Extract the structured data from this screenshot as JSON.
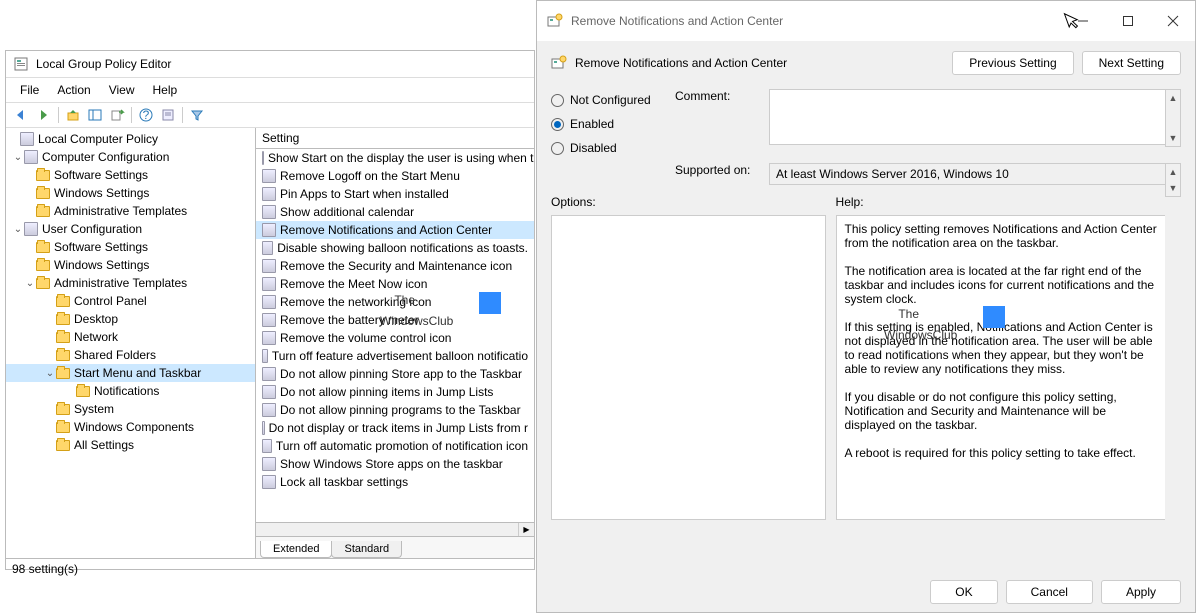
{
  "gpedit": {
    "title": "Local Group Policy Editor",
    "menus": [
      "File",
      "Action",
      "View",
      "Help"
    ],
    "tree": {
      "root": "Local Computer Policy",
      "cc": "Computer Configuration",
      "cc_children": [
        "Software Settings",
        "Windows Settings",
        "Administrative Templates"
      ],
      "uc": "User Configuration",
      "uc_sw": "Software Settings",
      "uc_ws": "Windows Settings",
      "uc_at": "Administrative Templates",
      "at_children_before": [
        "Control Panel",
        "Desktop",
        "Network",
        "Shared Folders"
      ],
      "at_selected": "Start Menu and Taskbar",
      "at_sel_child": "Notifications",
      "at_children_after": [
        "System",
        "Windows Components",
        "All Settings"
      ]
    },
    "list_header": "Setting",
    "settings": [
      "Show Start on the display the user is using when t",
      "Remove Logoff on the Start Menu",
      "Pin Apps to Start when installed",
      "Show additional calendar",
      "Remove Notifications and Action Center",
      "Disable showing balloon notifications as toasts.",
      "Remove the Security and Maintenance icon",
      "Remove the Meet Now icon",
      "Remove the networking icon",
      "Remove the battery meter",
      "Remove the volume control icon",
      "Turn off feature advertisement balloon notificatio",
      "Do not allow pinning Store app to the Taskbar",
      "Do not allow pinning items in Jump Lists",
      "Do not allow pinning programs to the Taskbar",
      "Do not display or track items in Jump Lists from r",
      "Turn off automatic promotion of notification icon",
      "Show Windows Store apps on the taskbar",
      "Lock all taskbar settings"
    ],
    "selected_setting_index": 4,
    "tabs": [
      "Extended",
      "Standard"
    ],
    "status": "98 setting(s)"
  },
  "dialog": {
    "title": "Remove Notifications and Action Center",
    "heading": "Remove Notifications and Action Center",
    "prev_btn": "Previous Setting",
    "next_btn": "Next Setting",
    "radios": {
      "not_configured": "Not Configured",
      "enabled": "Enabled",
      "disabled": "Disabled"
    },
    "selected_radio": "enabled",
    "comment_label": "Comment:",
    "supported_label": "Supported on:",
    "supported_value": "At least Windows Server 2016, Windows 10",
    "options_label": "Options:",
    "help_label": "Help:",
    "help_p1": "This policy setting removes Notifications and Action Center from the notification area on the taskbar.",
    "help_p2": "The notification area is located at the far right end of the taskbar and includes icons for current notifications and the system clock.",
    "help_p3": "If this setting is enabled, Notifications and Action Center is not displayed in the notification area. The user will be able to read notifications when they appear, but they won't be able to review any notifications they miss.",
    "help_p4": "If you disable or do not configure this policy setting, Notification and Security and Maintenance will be displayed on the taskbar.",
    "help_p5": "A reboot is required for this policy setting to take effect.",
    "ok": "OK",
    "cancel": "Cancel",
    "apply": "Apply"
  },
  "watermark": {
    "line1": "The",
    "line2": "WindowsClub"
  }
}
